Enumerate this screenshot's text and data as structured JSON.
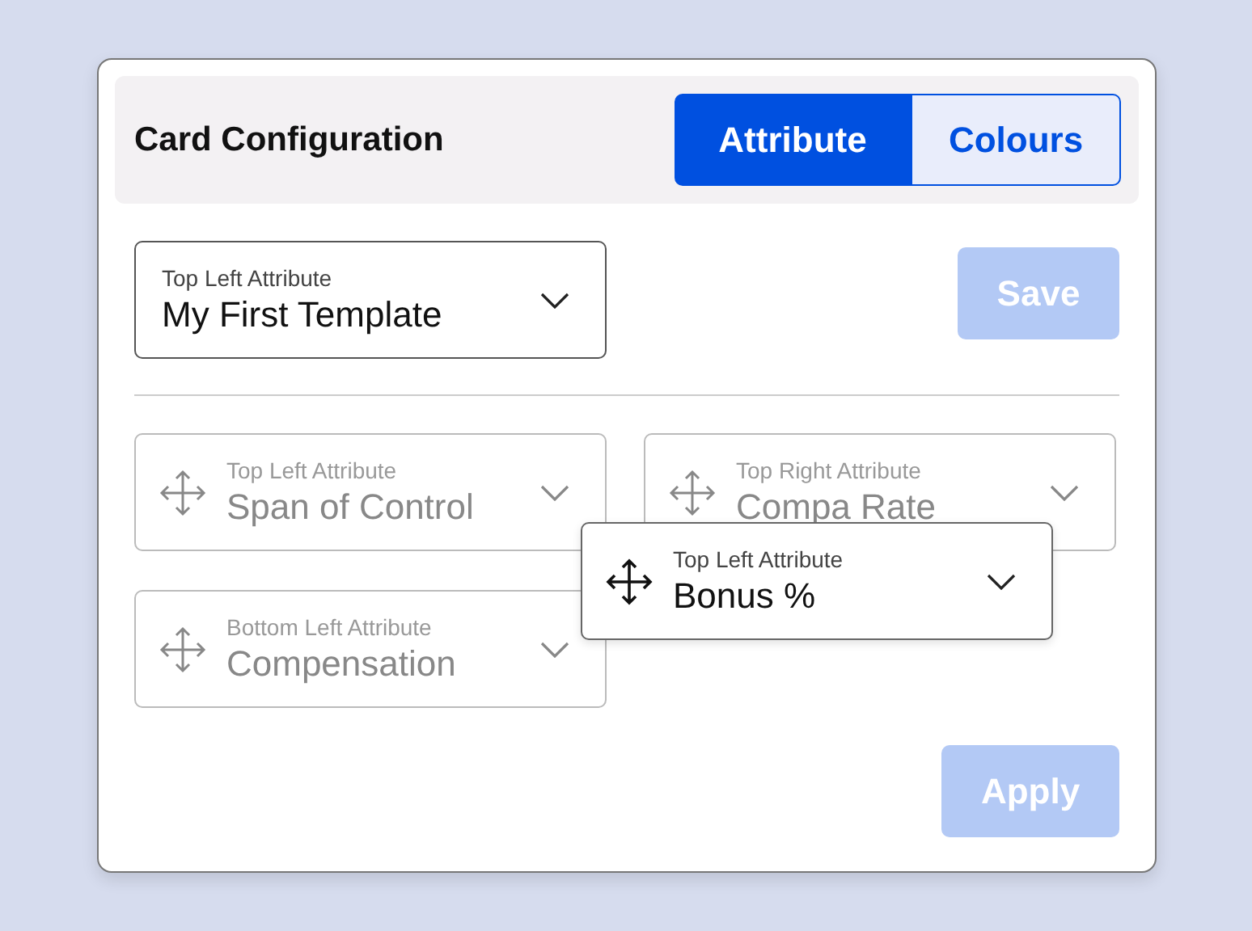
{
  "header": {
    "title": "Card Configuration"
  },
  "tabs": [
    {
      "label": "Attribute",
      "selected": true
    },
    {
      "label": "Colours",
      "selected": false
    }
  ],
  "template": {
    "label": "Top Left Attribute",
    "value": "My First Template"
  },
  "save_button": {
    "label": "Save",
    "disabled": true
  },
  "slots": [
    {
      "label": "Top Left Attribute",
      "value": "Span of Control",
      "dimmed": true
    },
    {
      "label": "Top Right Attribute",
      "value": "Compa Rate",
      "dimmed": true
    },
    {
      "label": "Bottom Left Attribute",
      "value": "Compensation",
      "dimmed": true
    }
  ],
  "dragged_slot": {
    "label": "Top Left Attribute",
    "value": "Bonus %",
    "dimmed": false
  },
  "apply_button": {
    "label": "Apply",
    "disabled": true
  }
}
